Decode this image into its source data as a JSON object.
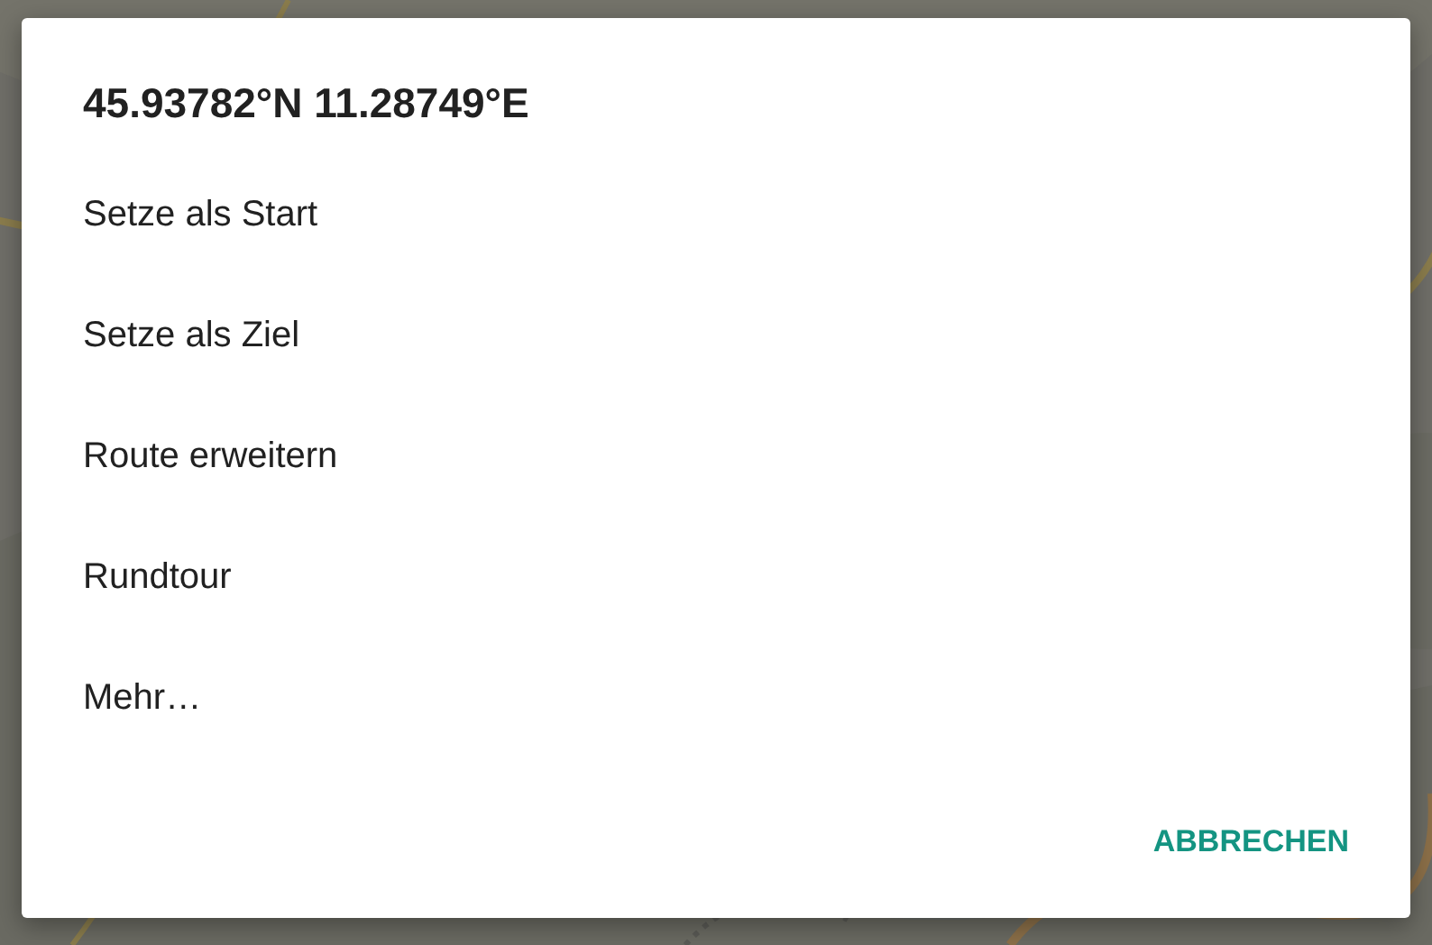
{
  "dialog": {
    "title": "45.93782°N 11.28749°E",
    "menu_items": [
      {
        "label": "Setze als Start"
      },
      {
        "label": "Setze als Ziel"
      },
      {
        "label": "Route erweitern"
      },
      {
        "label": "Rundtour"
      },
      {
        "label": "Mehr…"
      }
    ],
    "buttons": [
      {
        "label": "ABBRECHEN"
      }
    ]
  }
}
